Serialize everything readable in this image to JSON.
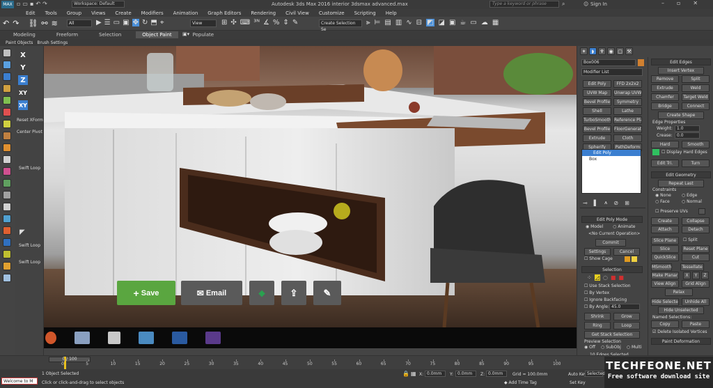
{
  "titlebar": {
    "workspace": "Workspace: Default",
    "title": "Autodesk 3ds Max 2016    interior 3dsmax advanced.max",
    "search_placeholder": "Type a keyword or phrase",
    "sign_in": "Sign In"
  },
  "menu": [
    "Edit",
    "Tools",
    "Group",
    "Views",
    "Create",
    "Modifiers",
    "Animation",
    "Graph Editors",
    "Rendering",
    "Civil View",
    "Customize",
    "Scripting",
    "Help"
  ],
  "toolbar": {
    "filter": "All",
    "ref_coord": "View",
    "selection_set": "Create Selection Se"
  },
  "ribbon": {
    "tabs": [
      "Modeling",
      "Freeform",
      "Selection",
      "Object Paint",
      "Populate"
    ],
    "subtabs": [
      "Paint Objects",
      "Brush Settings"
    ]
  },
  "left_panel": {
    "axes": [
      "X",
      "Y",
      "Z",
      "XY",
      "XY"
    ],
    "items": [
      "Reset XForm",
      "Center Pivot",
      "Swift Loop",
      "Swift Loop",
      "Swift Loop"
    ]
  },
  "share": {
    "save": "Save",
    "email": "Email"
  },
  "command_panel": {
    "object_name": "Box006",
    "modifier_list": "Modifier List",
    "modifier_buttons": [
      [
        "Edit Poly",
        "FFD 2x2x2"
      ],
      [
        "UVW Map",
        "Unwrap UVW"
      ],
      [
        "Bevel Profile",
        "Symmetry"
      ],
      [
        "Shell",
        "Lathe"
      ],
      [
        "TurboSmooth",
        "Reference Plane"
      ],
      [
        "Bevel Profile",
        "FloorGenerator"
      ],
      [
        "Extrude",
        "Cloth"
      ],
      [
        "Spherify",
        "PathDeform"
      ]
    ],
    "stack": [
      "Edit Poly",
      "Box"
    ],
    "edit_poly_mode": {
      "title": "Edit Poly Mode",
      "model": "Model",
      "animate": "Animate",
      "no_op": "<No Current Operation>",
      "commit": "Commit",
      "settings": "Settings",
      "cancel": "Cancel",
      "show_cage": "Show Cage"
    },
    "selection": {
      "title": "Selection",
      "use_stack": "Use Stack Selection",
      "by_vertex": "By Vertex",
      "ignore_bf": "Ignore Backfacing",
      "by_angle": "By Angle:",
      "angle_val": "45.0",
      "shrink": "Shrink",
      "grow": "Grow",
      "ring": "Ring",
      "loop": "Loop",
      "get_stack": "Get Stack Selection",
      "preview": "Preview Selection",
      "off": "Off",
      "subobj": "SubObj",
      "multi": "Multi",
      "edges_selected": "10 Edges Selected"
    }
  },
  "right_panel": {
    "edit_edges": "Edit Edges",
    "insert_vertex": "Insert Vertex",
    "remove": "Remove",
    "split": "Split",
    "extrude": "Extrude",
    "weld": "Weld",
    "chamfer": "Chamfer",
    "target_weld": "Target Weld",
    "bridge": "Bridge",
    "connect": "Connect",
    "create_shape": "Create Shape",
    "edge_props": "Edge Properties",
    "weight": "Weight:",
    "weight_val": "1.0",
    "crease": "Crease:",
    "crease_val": "0.0",
    "hard": "Hard",
    "smooth": "Smooth",
    "display_hard": "Display Hard Edges",
    "edit_tri": "Edit Tri.",
    "turn": "Turn",
    "edit_geometry": "Edit Geometry",
    "repeat_last": "Repeat Last",
    "constraints": "Constraints",
    "none": "None",
    "edge": "Edge",
    "face": "Face",
    "normal": "Normal",
    "preserve_uvs": "Preserve UVs",
    "create": "Create",
    "collapse": "Collapse",
    "attach": "Attach",
    "detach": "Detach",
    "slice_plane": "Slice Plane",
    "split2": "Split",
    "slice": "Slice",
    "reset_plane": "Reset Plane",
    "quickslice": "QuickSlice",
    "cut": "Cut",
    "msmooth": "MSmooth",
    "tessellate": "Tessellate",
    "make_planar": "Make Planar",
    "x": "X",
    "y": "Y",
    "z": "Z",
    "view_align": "View Align",
    "grid_align": "Grid Align",
    "relax": "Relax",
    "hide_selected": "Hide Selected",
    "unhide_all": "Unhide All",
    "hide_unselected": "Hide Unselected",
    "named_sel": "Named Selections:",
    "copy": "Copy",
    "paste": "Paste",
    "delete_isolated": "Delete Isolated Vertices",
    "paint_deform": "Paint Deformation"
  },
  "timeline": {
    "counter": "0 / 100",
    "ticks": [
      "0",
      "5",
      "10",
      "15",
      "20",
      "25",
      "30",
      "35",
      "40",
      "45",
      "50",
      "55",
      "60",
      "65",
      "70",
      "75",
      "80",
      "85",
      "90",
      "95",
      "100"
    ]
  },
  "status": {
    "welcome": "Welcome to M",
    "objects": "1 Object Selected",
    "prompt": "Click or click-and-drag to select objects",
    "x_label": "X:",
    "x_val": "0.0mm",
    "y_label": "Y:",
    "y_val": "0.0mm",
    "z_label": "Z:",
    "z_val": "0.0mm",
    "grid": "Grid = 100.0mm",
    "add_time_tag": "Add Time Tag",
    "auto_key": "Auto Key",
    "set_key": "Set Key",
    "selected": "Selected"
  },
  "watermark": {
    "brand": "TECHFEONE.NET",
    "tagline": "Free software download site"
  }
}
